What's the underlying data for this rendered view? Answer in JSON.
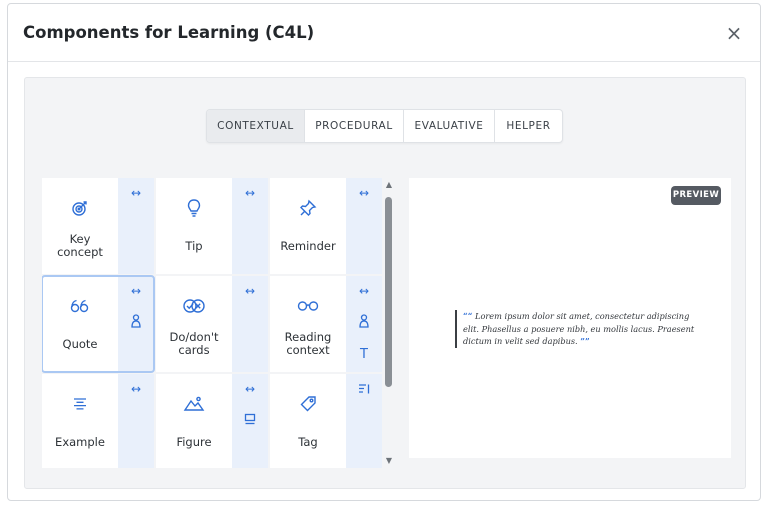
{
  "dialog": {
    "title": "Components for Learning (C4L)",
    "close_label": "×"
  },
  "tabs": [
    {
      "label": "CONTEXTUAL",
      "active": true
    },
    {
      "label": "PROCEDURAL",
      "active": false
    },
    {
      "label": "EVALUATIVE",
      "active": false
    },
    {
      "label": "HELPER",
      "active": false
    }
  ],
  "components": {
    "key_concept": {
      "label_line1": "Key",
      "label_line2": "concept",
      "icon": "target-icon",
      "side": [
        "expand-horizontal-icon"
      ]
    },
    "tip": {
      "label": "Tip",
      "icon": "lightbulb-icon",
      "side": [
        "expand-horizontal-icon"
      ]
    },
    "reminder": {
      "label": "Reminder",
      "icon": "pushpin-icon",
      "side": [
        "expand-horizontal-icon"
      ]
    },
    "quote": {
      "label": "Quote",
      "icon": "quote-icon",
      "selected": true,
      "side": [
        "expand-horizontal-icon",
        "user-icon"
      ]
    },
    "do_dont": {
      "label_line1": "Do/don't",
      "label_line2": "cards",
      "icon": "check-cross-icon",
      "side": [
        "expand-horizontal-icon"
      ]
    },
    "reading_context": {
      "label_line1": "Reading",
      "label_line2": "context",
      "icon": "glasses-icon",
      "side": [
        "expand-horizontal-icon",
        "user-icon",
        "text-icon"
      ]
    },
    "example": {
      "label": "Example",
      "icon": "align-center-icon",
      "side": [
        "expand-horizontal-icon"
      ]
    },
    "figure": {
      "label": "Figure",
      "icon": "mountain-image-icon",
      "side": [
        "expand-horizontal-icon",
        "caption-icon"
      ]
    },
    "tag": {
      "label": "Tag",
      "icon": "tag-icon",
      "side": [
        "wrap-text-icon"
      ]
    }
  },
  "side_glyphs": {
    "expand": "↔",
    "text": "T"
  },
  "preview": {
    "badge": "PREVIEW",
    "open_quote": "““",
    "close_quote": "””",
    "text": "Lorem ipsum dolor sit amet, consectetur adipiscing elit. Phasellus a posuere nibh, eu mollis lacus. Praesent dictum in velit sed dapibus."
  },
  "colors": {
    "accent": "#2f6fd6",
    "side_panel": "#e9f0fb",
    "selected_outline": "#aac8f3",
    "badge": "#555a62"
  }
}
